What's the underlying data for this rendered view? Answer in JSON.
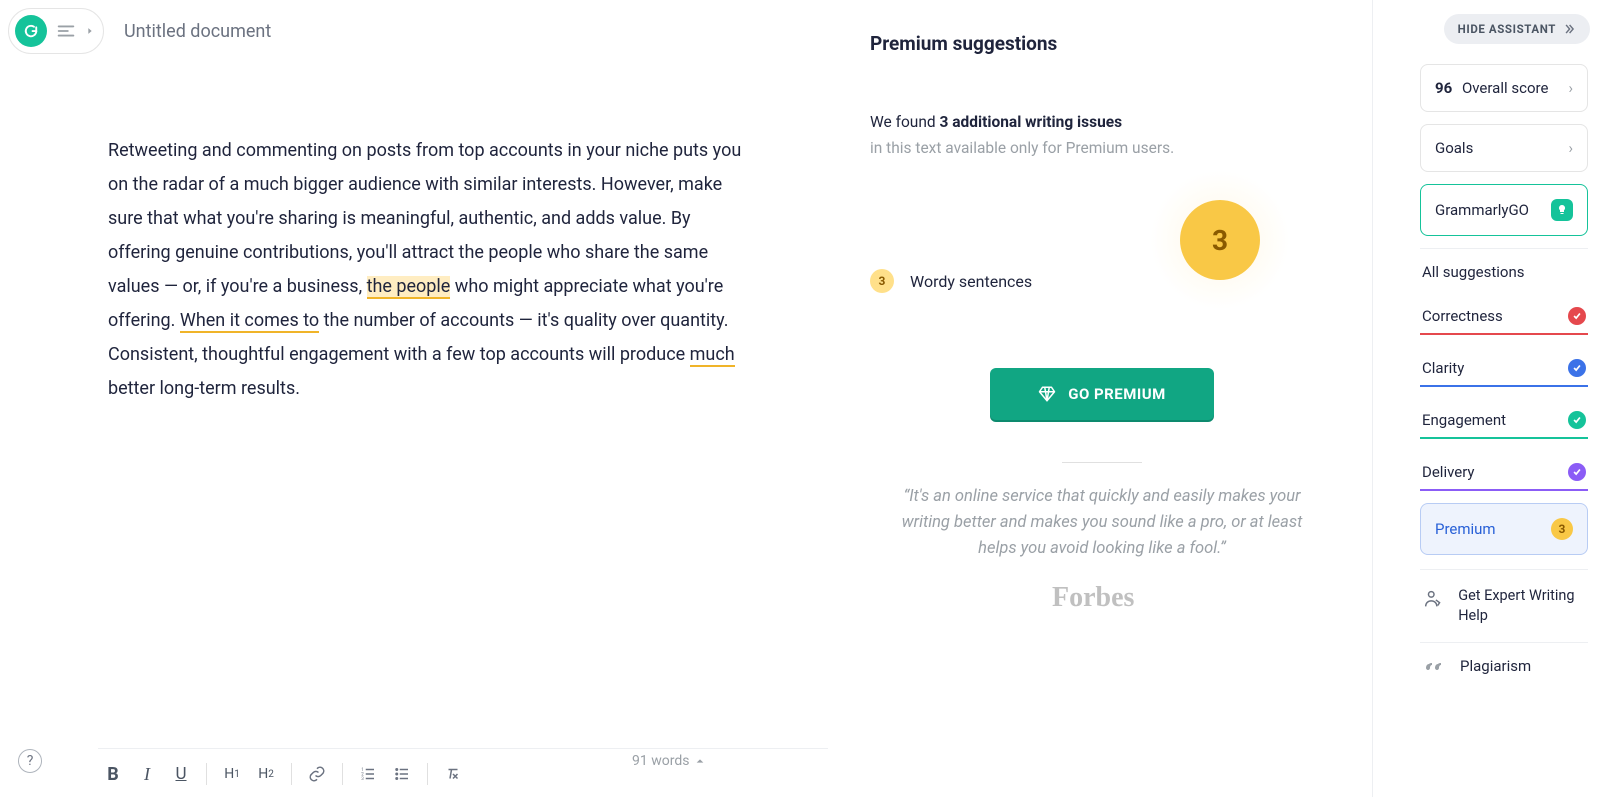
{
  "header": {
    "title": "Untitled document"
  },
  "editor": {
    "p1_a": "Retweeting and commenting on posts from top accounts in your niche puts you on the radar of a much bigger audience with similar interests. However, make sure that what you're sharing is meaningful, authentic, and adds value. By offering genuine contributions, you'll attract the people who share the same values — or, if you're a business, ",
    "hl1": "the people",
    "p1_b": " who might appreciate what you're offering. ",
    "hl2": "When it comes to",
    "p1_c": " the number of accounts — it's quality over quantity. Consistent, thoughtful engagement with a few top accounts will produce ",
    "hl3": "much",
    "p1_d": " better long-term results."
  },
  "premium": {
    "title": "Premium suggestions",
    "found_prefix": "We found ",
    "found_bold": "3 additional writing issues",
    "avail": "in this text available only for Premium users.",
    "issue_count": "3",
    "issue_label": "Wordy sentences",
    "big_count": "3",
    "cta": "GO PREMIUM",
    "quote": "“It's an online service that quickly and easily makes your writing better and makes you sound like a pro, or at least helps you avoid looking like a fool.”",
    "source": "Forbes"
  },
  "rail": {
    "hide": "HIDE ASSISTANT",
    "score_num": "96",
    "score_label": " Overall score",
    "goals": "Goals",
    "go": "GrammarlyGO",
    "all": "All suggestions",
    "correctness": "Correctness",
    "clarity": "Clarity",
    "engagement": "Engagement",
    "delivery": "Delivery",
    "premium": "Premium",
    "premium_count": "3",
    "expert": "Get Expert Writing Help",
    "plag": "Plagiarism"
  },
  "footer": {
    "words": "91 words"
  },
  "colors": {
    "correctness": "#e5484d",
    "clarity": "#3b72e8",
    "engagement": "#15c39a",
    "delivery": "#8b5cf6"
  }
}
